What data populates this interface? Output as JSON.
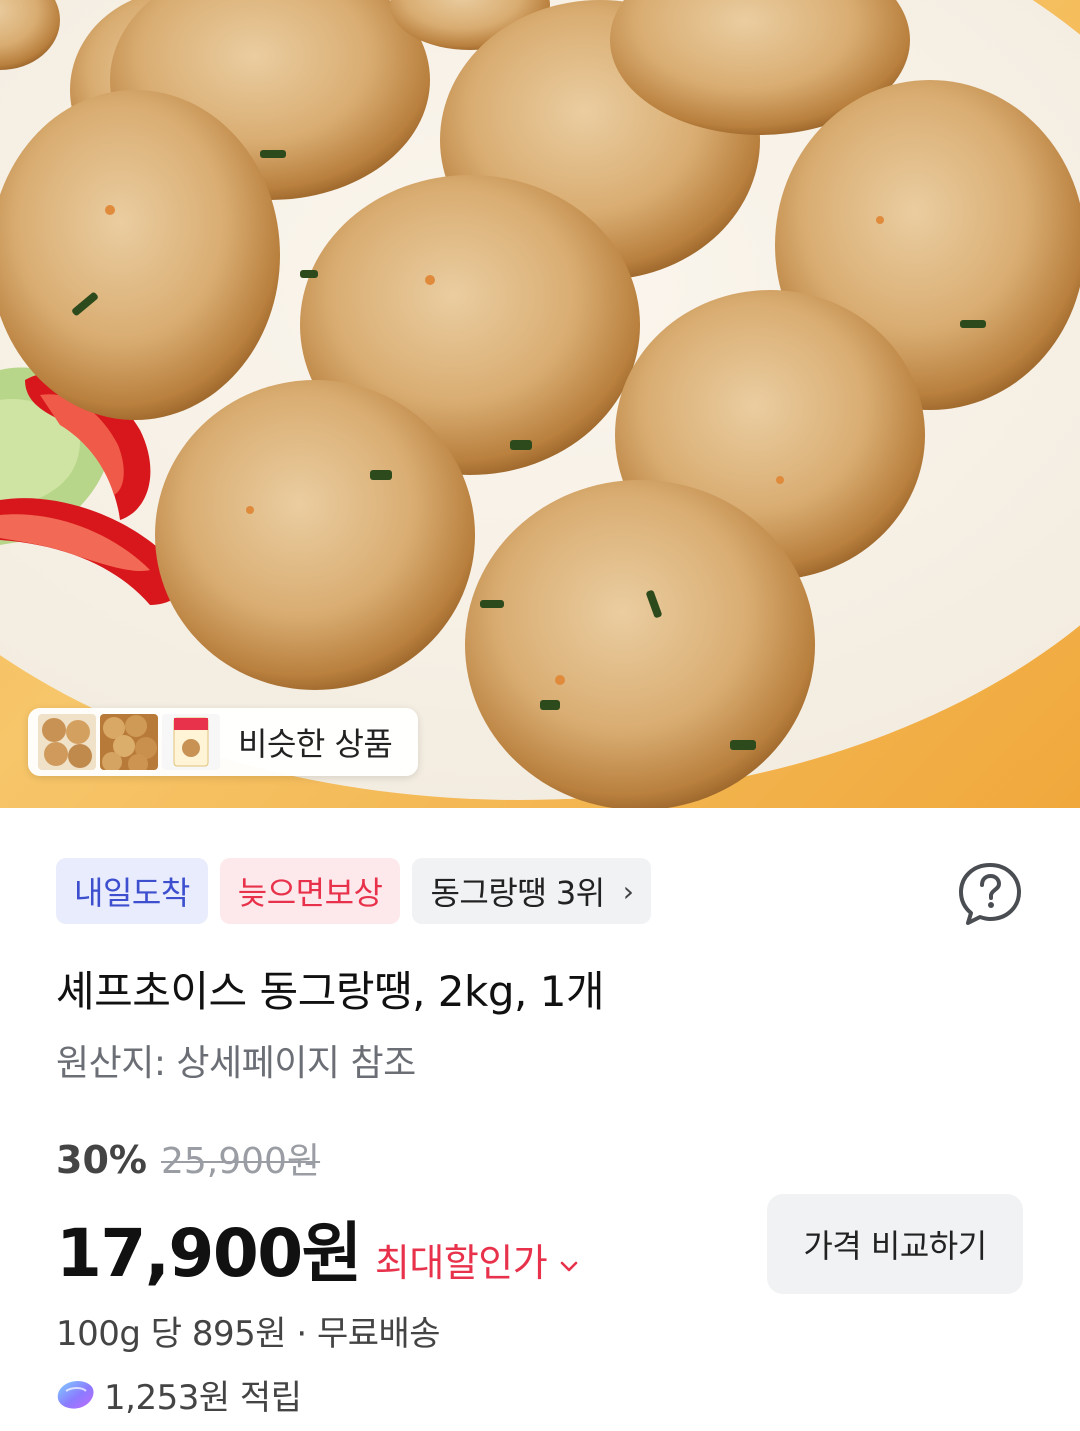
{
  "hero": {
    "image_icon": "meatball-product-photo",
    "similar": {
      "label": "비슷한 상품",
      "thumbnails": [
        "meatball-thumb-icon",
        "meatball-tray-thumb-icon",
        "product-package-thumb-icon"
      ]
    }
  },
  "badges": {
    "tomorrow": "내일도착",
    "late_compensation": "늦으면보상",
    "rank": "동그랑땡 3위",
    "rank_chevron": "›"
  },
  "help_icon": "question-bubble-icon",
  "product": {
    "title": "셰프초이스 동그랑땡, 2kg, 1개",
    "origin": "원산지: 상세페이지 참조"
  },
  "price": {
    "discount_rate": "30%",
    "original": "25,900원",
    "final": "17,900원",
    "max_discount_label": "최대할인가",
    "compare_button": "가격 비교하기",
    "unit_shipping": "100g 당 895원 · 무료배송",
    "rewards": "1,253원 적립"
  },
  "colors": {
    "tomorrow_badge_bg": "#e9ecfc",
    "tomorrow_badge_text": "#3d4fcf",
    "late_badge_bg": "#fde9ec",
    "accent_red": "#e8324b",
    "button_bg": "#f1f2f4"
  }
}
